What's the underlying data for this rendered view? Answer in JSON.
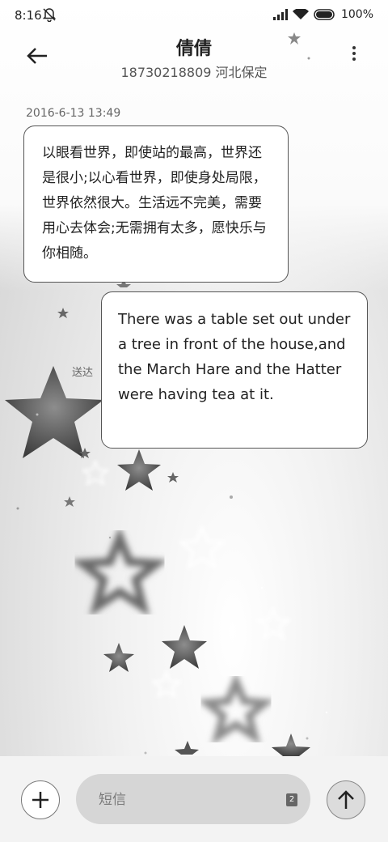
{
  "status_bar": {
    "time": "8:16",
    "battery": "100%"
  },
  "header": {
    "contact_name": "倩倩",
    "contact_sub": "18730218809 河北保定"
  },
  "conversation": {
    "timestamp": "2016-6-13 13:49",
    "messages": [
      {
        "text": "以眼看世界，即使站的最高，世界还是很小;以心看世界，即使身处局限，世界依然很大。生活远不完美，需要用心去体会;无需拥有太多，愿快乐与你相随。"
      },
      {
        "text": "There was a table set out under a tree in front of the house,and the March Hare and the Hatter were having tea at it."
      }
    ],
    "delivered_label": "送达"
  },
  "composer": {
    "placeholder": "短信",
    "sim_badge": "2"
  },
  "icons": {
    "back": "arrow-left-icon",
    "more": "more-vertical-icon",
    "add": "plus-icon",
    "send": "arrow-up-icon",
    "bell_muted": "bell-off-icon",
    "signal": "signal-icon",
    "wifi": "wifi-icon",
    "battery": "battery-icon"
  }
}
